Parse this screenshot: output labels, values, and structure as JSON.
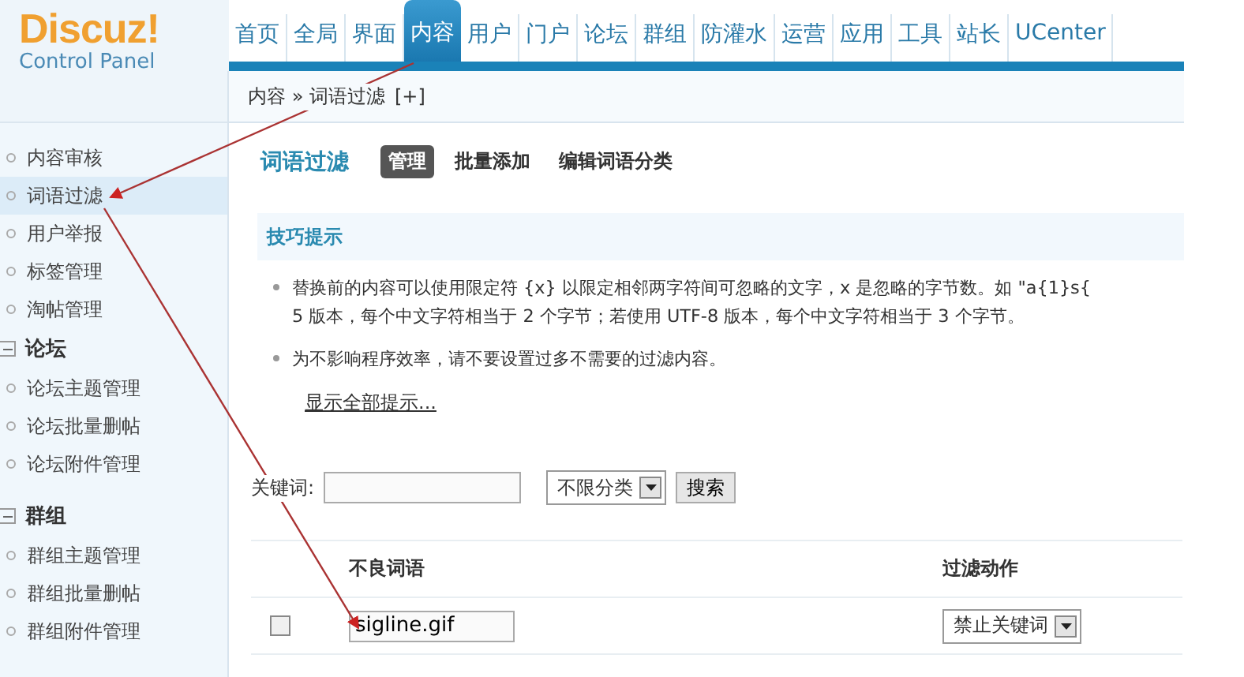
{
  "logo": {
    "name": "Discuz!",
    "subtitle": "Control Panel"
  },
  "nav": [
    {
      "label": "首页",
      "selected": false
    },
    {
      "label": "全局",
      "selected": false
    },
    {
      "label": "界面",
      "selected": false
    },
    {
      "label": "内容",
      "selected": true
    },
    {
      "label": "用户",
      "selected": false
    },
    {
      "label": "门户",
      "selected": false
    },
    {
      "label": "论坛",
      "selected": false
    },
    {
      "label": "群组",
      "selected": false
    },
    {
      "label": "防灌水",
      "selected": false
    },
    {
      "label": "运营",
      "selected": false
    },
    {
      "label": "应用",
      "selected": false
    },
    {
      "label": "工具",
      "selected": false
    },
    {
      "label": "站长",
      "selected": false
    },
    {
      "label": "UCenter",
      "selected": false
    }
  ],
  "breadcrumb": {
    "path": "内容 » 词语过滤",
    "add": "[+]"
  },
  "sidebar": [
    {
      "items": [
        {
          "label": "内容审核",
          "selected": false
        },
        {
          "label": "词语过滤",
          "selected": true
        },
        {
          "label": "用户举报",
          "selected": false
        },
        {
          "label": "标签管理",
          "selected": false
        },
        {
          "label": "淘帖管理",
          "selected": false
        }
      ]
    },
    {
      "title": "论坛",
      "expanded": true,
      "items": [
        {
          "label": "论坛主题管理",
          "selected": false
        },
        {
          "label": "论坛批量删帖",
          "selected": false
        },
        {
          "label": "论坛附件管理",
          "selected": false
        }
      ]
    },
    {
      "title": "群组",
      "expanded": true,
      "items": [
        {
          "label": "群组主题管理",
          "selected": false
        },
        {
          "label": "群组批量删帖",
          "selected": false
        },
        {
          "label": "群组附件管理",
          "selected": false
        }
      ]
    }
  ],
  "page_title": "词语过滤",
  "subtabs": [
    {
      "label": "管理",
      "selected": true
    },
    {
      "label": "批量添加",
      "selected": false
    },
    {
      "label": "编辑词语分类",
      "selected": false
    }
  ],
  "tips": {
    "title": "技巧提示",
    "items": [
      {
        "lines": [
          "替换前的内容可以使用限定符 {x} 以限定相邻两字符间可忽略的文字，x 是忽略的字节数。如 \"a{1}s{",
          "5 版本，每个中文字符相当于 2 个字节；若使用 UTF-8 版本，每个中文字符相当于 3 个字节。"
        ]
      },
      {
        "lines": [
          "为不影响程序效率，请不要设置过多不需要的过滤内容。"
        ]
      }
    ],
    "show_all": "显示全部提示..."
  },
  "search": {
    "label": "关键词:",
    "category": "不限分类",
    "button": "搜索"
  },
  "table": {
    "columns": [
      "不良词语",
      "过滤动作"
    ],
    "rows": [
      {
        "checked": false,
        "word": "sigline.gif",
        "action": "禁止关键词"
      }
    ]
  }
}
